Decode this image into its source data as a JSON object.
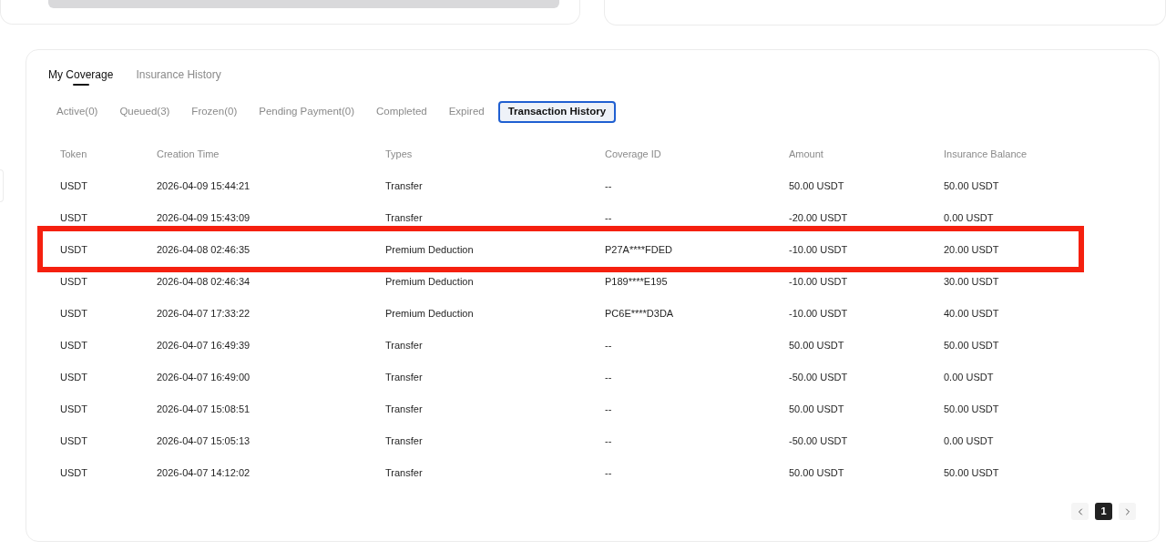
{
  "main_tabs": [
    {
      "label": "My Coverage",
      "selected": true
    },
    {
      "label": "Insurance History",
      "selected": false
    }
  ],
  "sub_tabs": [
    {
      "label": "Active(0)",
      "selected": false
    },
    {
      "label": "Queued(3)",
      "selected": false
    },
    {
      "label": "Frozen(0)",
      "selected": false
    },
    {
      "label": "Pending Payment(0)",
      "selected": false
    },
    {
      "label": "Completed",
      "selected": false
    },
    {
      "label": "Expired",
      "selected": false
    },
    {
      "label": "Transaction History",
      "selected": true
    }
  ],
  "table": {
    "columns": [
      "Token",
      "Creation Time",
      "Types",
      "Coverage ID",
      "Amount",
      "Insurance Balance"
    ],
    "rows": [
      {
        "cells": [
          "USDT",
          "2026-04-09 15:44:21",
          "Transfer",
          "--",
          "50.00 USDT",
          "50.00 USDT"
        ],
        "highlighted": false
      },
      {
        "cells": [
          "USDT",
          "2026-04-09 15:43:09",
          "Transfer",
          "--",
          "-20.00 USDT",
          "0.00 USDT"
        ],
        "highlighted": false
      },
      {
        "cells": [
          "USDT",
          "2026-04-08 02:46:35",
          "Premium Deduction",
          "P27A****FDED",
          "-10.00 USDT",
          "20.00 USDT"
        ],
        "highlighted": true
      },
      {
        "cells": [
          "USDT",
          "2026-04-08 02:46:34",
          "Premium Deduction",
          "P189****E195",
          "-10.00 USDT",
          "30.00 USDT"
        ],
        "highlighted": false
      },
      {
        "cells": [
          "USDT",
          "2026-04-07 17:33:22",
          "Premium Deduction",
          "PC6E****D3DA",
          "-10.00 USDT",
          "40.00 USDT"
        ],
        "highlighted": false
      },
      {
        "cells": [
          "USDT",
          "2026-04-07 16:49:39",
          "Transfer",
          "--",
          "50.00 USDT",
          "50.00 USDT"
        ],
        "highlighted": false
      },
      {
        "cells": [
          "USDT",
          "2026-04-07 16:49:00",
          "Transfer",
          "--",
          "-50.00 USDT",
          "0.00 USDT"
        ],
        "highlighted": false
      },
      {
        "cells": [
          "USDT",
          "2026-04-07 15:08:51",
          "Transfer",
          "--",
          "50.00 USDT",
          "50.00 USDT"
        ],
        "highlighted": false
      },
      {
        "cells": [
          "USDT",
          "2026-04-07 15:05:13",
          "Transfer",
          "--",
          "-50.00 USDT",
          "0.00 USDT"
        ],
        "highlighted": false
      },
      {
        "cells": [
          "USDT",
          "2026-04-07 14:12:02",
          "Transfer",
          "--",
          "50.00 USDT",
          "50.00 USDT"
        ],
        "highlighted": false
      }
    ]
  },
  "pagination": {
    "pages": [
      {
        "label": "1",
        "selected": true
      }
    ]
  }
}
